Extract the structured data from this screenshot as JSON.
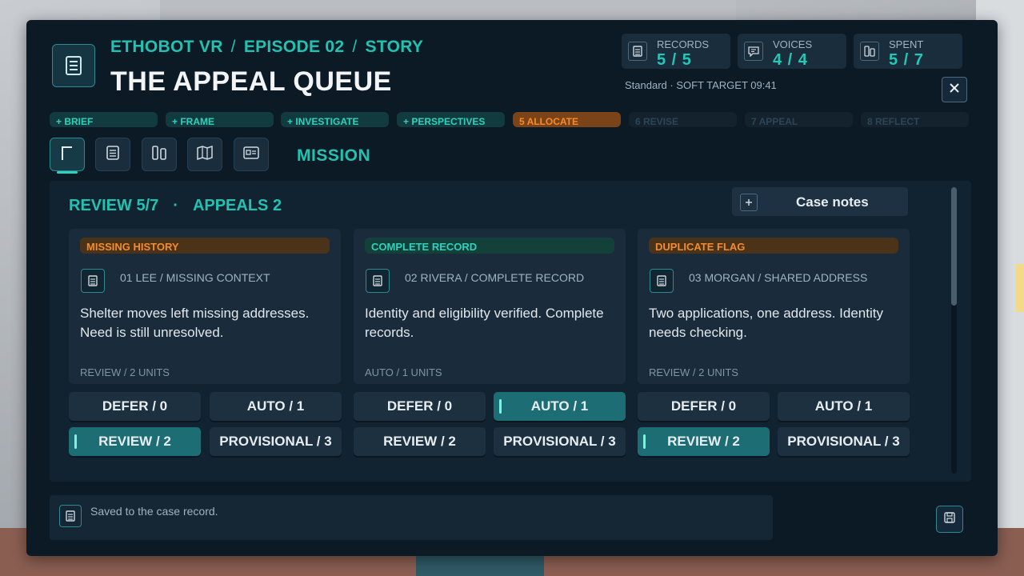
{
  "header": {
    "breadcrumb": [
      "ETHOBOT VR",
      "EPISODE 02",
      "STORY"
    ],
    "title": "THE APPEAL QUEUE",
    "stats": [
      {
        "label": "RECORDS",
        "value": "5 / 5",
        "icon": "document-icon"
      },
      {
        "label": "VOICES",
        "value": "4 / 4",
        "icon": "speech-bubble-icon"
      },
      {
        "label": "SPENT",
        "value": "5 / 7",
        "icon": "columns-icon"
      }
    ],
    "subline": "Standard · SOFT TARGET  09:41",
    "close_icon": "close-icon"
  },
  "steps": [
    {
      "label": "+ BRIEF",
      "state": "done"
    },
    {
      "label": "+ FRAME",
      "state": "done"
    },
    {
      "label": "+ INVESTIGATE",
      "state": "done"
    },
    {
      "label": "+ PERSPECTIVES",
      "state": "done"
    },
    {
      "label": "5  ALLOCATE",
      "state": "active"
    },
    {
      "label": "6  REVISE",
      "state": "locked"
    },
    {
      "label": "7  APPEAL",
      "state": "locked"
    },
    {
      "label": "8  REFLECT",
      "state": "locked"
    }
  ],
  "toolbar": {
    "tools": [
      "flag-icon",
      "document-icon",
      "columns-icon",
      "map-icon",
      "screen-icon"
    ],
    "active_index": 0,
    "section_label": "MISSION"
  },
  "summary": {
    "review": "REVIEW  5/7",
    "dot": "·",
    "appeals": "APPEALS  2"
  },
  "case_notes_label": "Case notes",
  "cards": [
    {
      "tag": "MISSING HISTORY",
      "tag_color": "#f58b2b",
      "record": "01  LEE / MISSING CONTEXT",
      "description": "Shelter moves left missing addresses. Need is still unresolved.",
      "mode": "REVIEW / 2 UNITS",
      "options": [
        "DEFER / 0",
        "AUTO / 1",
        "REVIEW / 2",
        "PROVISIONAL / 3"
      ],
      "selected": 2
    },
    {
      "tag": "COMPLETE RECORD",
      "tag_color": "#2fd1bd",
      "record": "02  RIVERA / COMPLETE RECORD",
      "description": "Identity and eligibility verified. Complete records.",
      "mode": "AUTO / 1 UNITS",
      "options": [
        "DEFER / 0",
        "AUTO / 1",
        "REVIEW / 2",
        "PROVISIONAL / 3"
      ],
      "selected": 1
    },
    {
      "tag": "DUPLICATE FLAG",
      "tag_color": "#f58b2b",
      "record": "03  MORGAN / SHARED ADDRESS",
      "description": "Two applications, one address. Identity needs checking.",
      "mode": "REVIEW / 2 UNITS",
      "options": [
        "DEFER / 0",
        "AUTO / 1",
        "REVIEW / 2",
        "PROVISIONAL / 3"
      ],
      "selected": 2
    }
  ],
  "status": {
    "message": "Saved to the case record."
  },
  "colors": {
    "accent": "#22c2b3",
    "warning": "#f58b2b",
    "panel": "#0c1a26"
  }
}
